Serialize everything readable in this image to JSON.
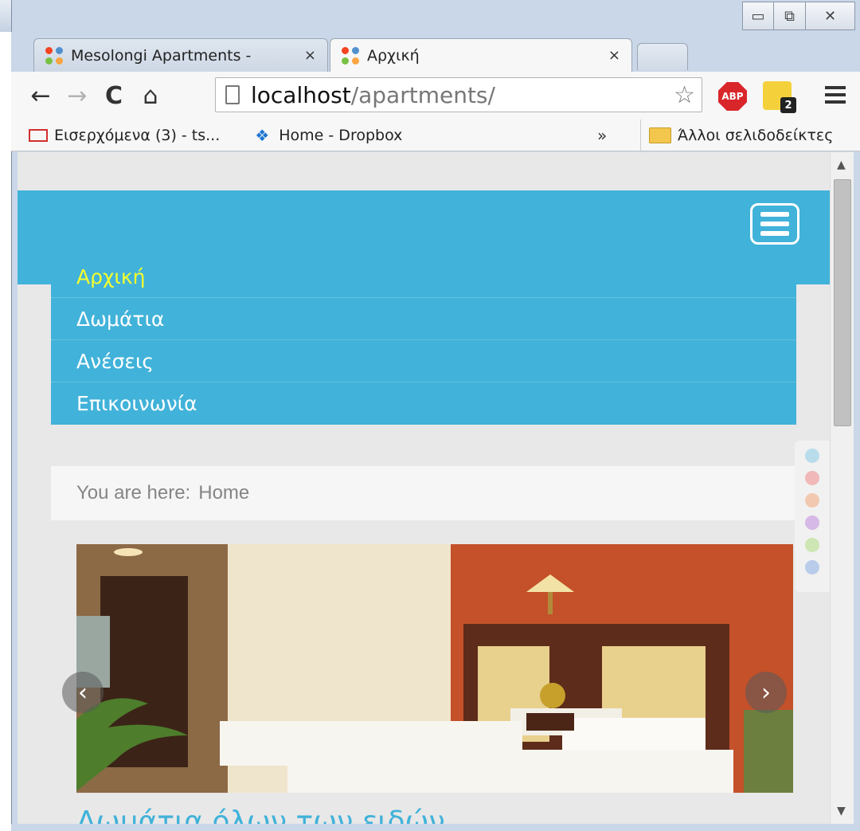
{
  "window": {
    "minimize_glyph": "▭",
    "maximize_glyph": "⧉",
    "close_glyph": "✕"
  },
  "tabs": [
    {
      "title": "Mesolongi Apartments -",
      "close": "×",
      "active": false,
      "icon": "joomla-icon"
    },
    {
      "title": "Αρχική",
      "close": "×",
      "active": true,
      "icon": "joomla-icon"
    }
  ],
  "toolbar": {
    "back": "←",
    "forward": "→",
    "reload": "C",
    "home": "⌂",
    "url_host": "localhost",
    "url_path": "/apartments/",
    "star": "☆",
    "abp_label": "ABP",
    "extension_badge": "2"
  },
  "bookmarks": {
    "items": [
      {
        "label": "Εισερχόμενα (3) - ts...",
        "icon": "gmail-icon"
      },
      {
        "label": "Home - Dropbox",
        "icon": "dropbox-icon"
      }
    ],
    "more": "»",
    "other": "Άλλοι σελιδοδείκτες"
  },
  "page": {
    "nav": [
      {
        "label": "Αρχική",
        "active": true
      },
      {
        "label": "Δωμάτια",
        "active": false
      },
      {
        "label": "Ανέσεις",
        "active": false
      },
      {
        "label": "Επικοινωνία",
        "active": false
      }
    ],
    "breadcrumb_prefix": "You are here:",
    "breadcrumb_current": "Home",
    "color_swatches": [
      "#b9dcea",
      "#f0b8b8",
      "#f2c9b0",
      "#d6b9e6",
      "#cde6b3",
      "#b9cdea"
    ],
    "slider_prev": "‹",
    "slider_next": "›",
    "caption": "Δωμάτια όλων των ειδών"
  },
  "colors": {
    "accent": "#41b2d9",
    "active_nav": "#f3ff2e"
  }
}
